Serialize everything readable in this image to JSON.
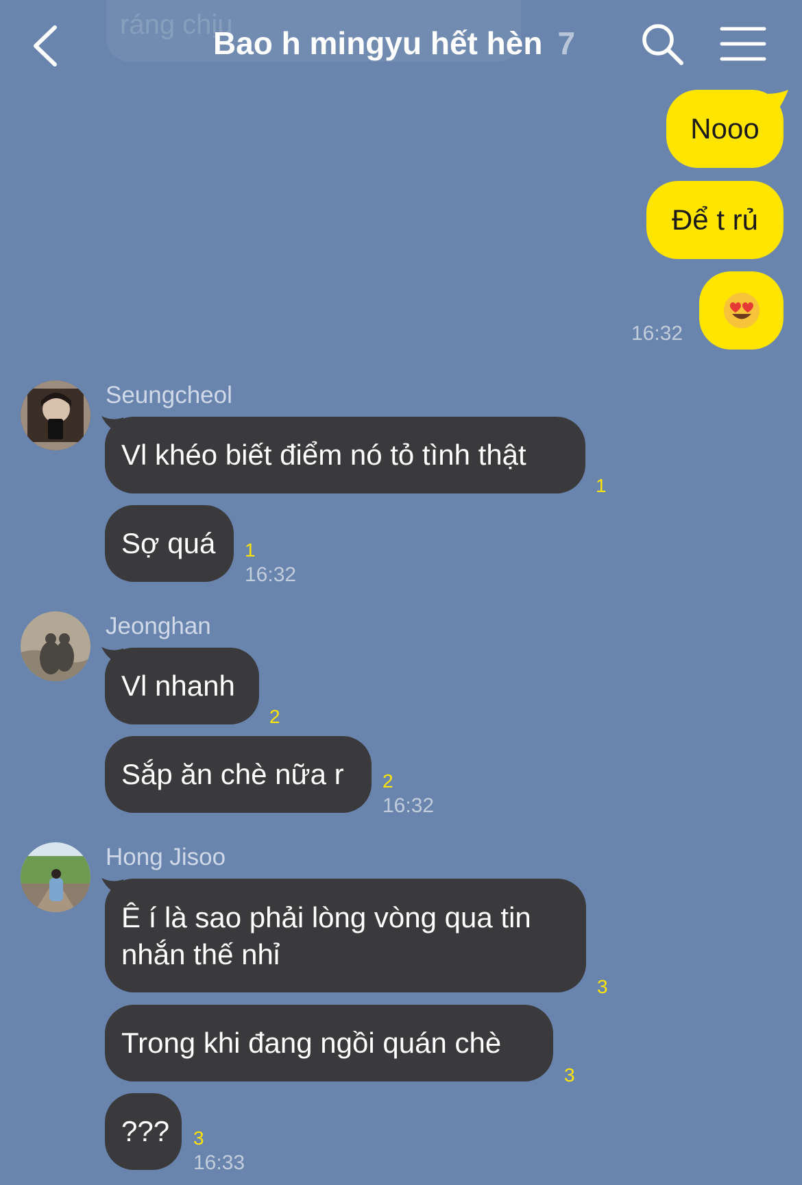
{
  "header": {
    "ghost_text": "ráng chịu",
    "title": "Bao h mingyu hết hèn",
    "member_count": "7"
  },
  "sent": {
    "messages": [
      "Nooo",
      "Để t rủ",
      "😍"
    ],
    "time": "16:32"
  },
  "groups": [
    {
      "sender": "Seungcheol",
      "messages": [
        {
          "text": "Vl khéo biết điểm nó tỏ tình thật",
          "unread": "1"
        },
        {
          "text": "Sợ quá",
          "unread": "1"
        }
      ],
      "time": "16:32"
    },
    {
      "sender": "Jeonghan",
      "messages": [
        {
          "text": "Vl nhanh",
          "unread": "2"
        },
        {
          "text": "Sắp ăn chè nữa r",
          "unread": "2"
        }
      ],
      "time": "16:32"
    },
    {
      "sender": "Hong Jisoo",
      "messages": [
        {
          "text": "Ê í là sao phải lòng vòng qua tin nhắn thế nhỉ",
          "unread": "3"
        },
        {
          "text": "Trong khi đang ngồi quán chè",
          "unread": "3"
        },
        {
          "text": "???",
          "unread": "3"
        }
      ],
      "time": "16:33"
    }
  ],
  "colors": {
    "background": "#6a85ad",
    "sent_bubble": "#ffe500",
    "received_bubble": "#3a3a3c",
    "unread": "#ffe500"
  }
}
